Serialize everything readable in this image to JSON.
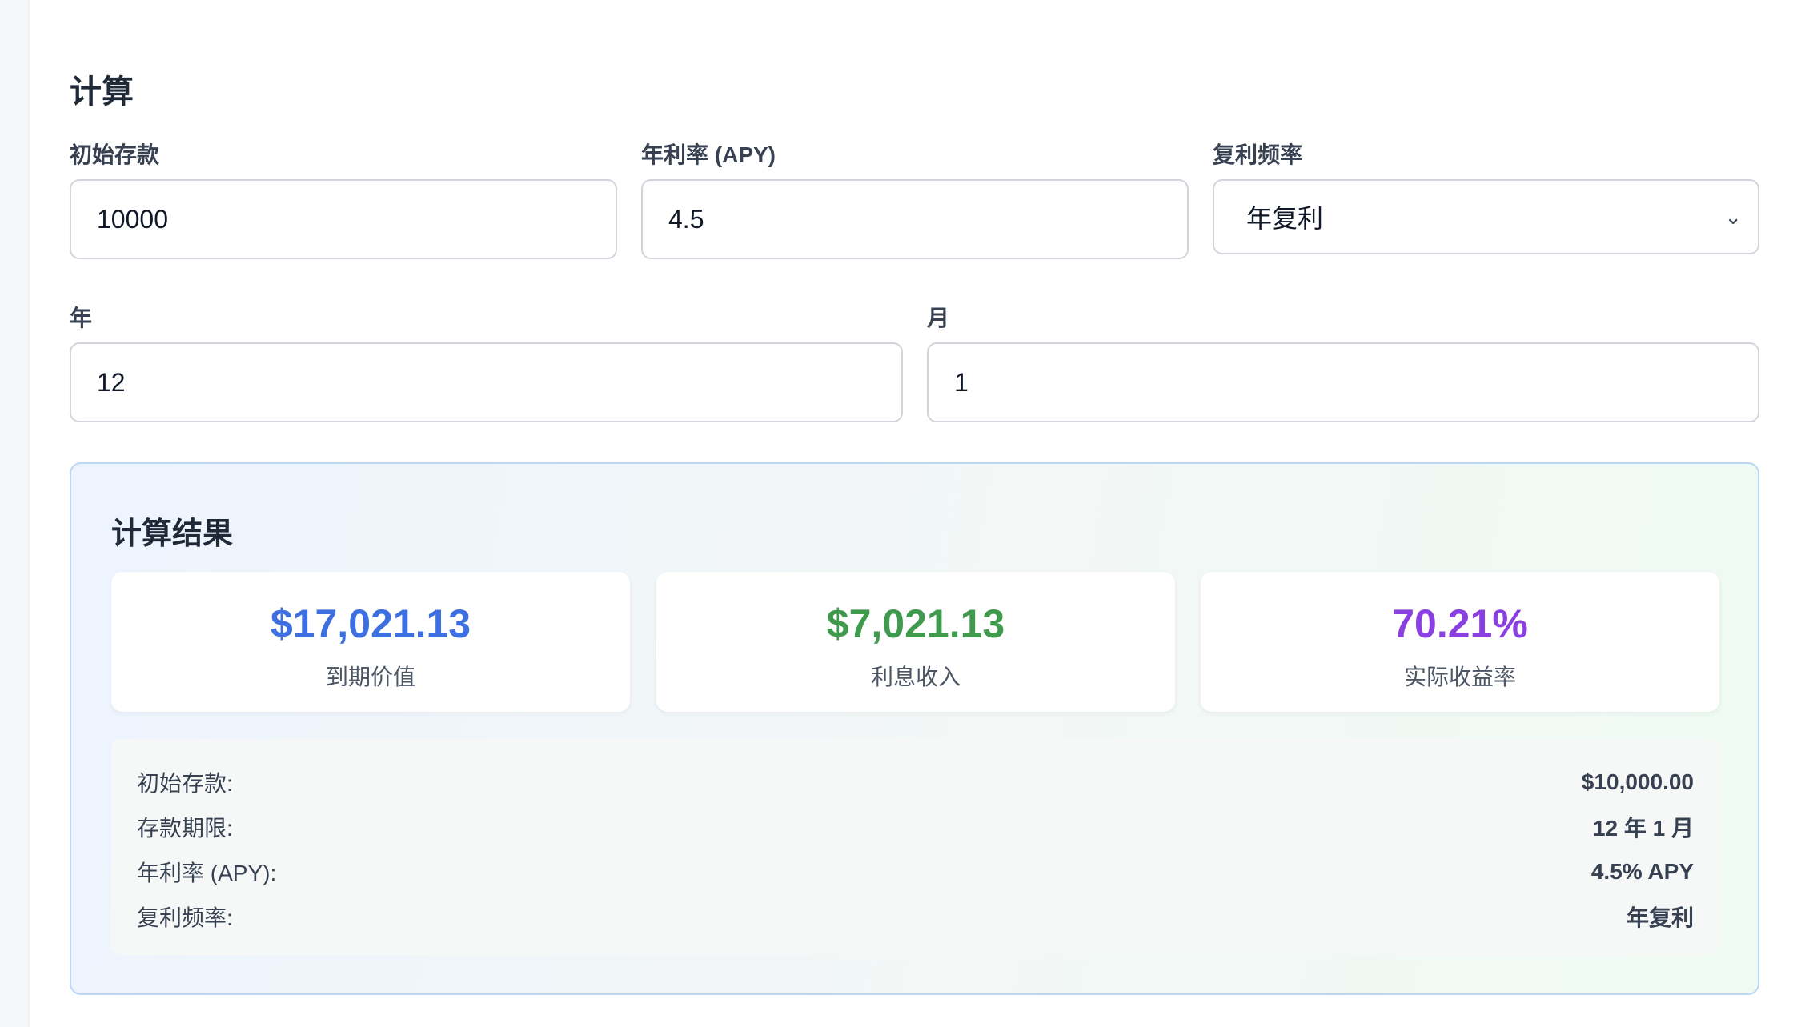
{
  "calc": {
    "title": "计算",
    "deposit": {
      "label": "初始存款",
      "value": "10000"
    },
    "rate": {
      "label": "年利率 (APY)",
      "value": "4.5"
    },
    "frequency": {
      "label": "复利频率",
      "value": "年复利",
      "icon": "chevron-down-icon"
    },
    "years": {
      "label": "年",
      "value": "12"
    },
    "months": {
      "label": "月",
      "value": "1"
    }
  },
  "results": {
    "title": "计算结果",
    "cards": [
      {
        "value": "$17,021.13",
        "label": "到期价值",
        "color": "#3e6fe0"
      },
      {
        "value": "$7,021.13",
        "label": "利息收入",
        "color": "#3f9a4e"
      },
      {
        "value": "70.21%",
        "label": "实际收益率",
        "color": "#8a3fe0"
      }
    ],
    "details": [
      {
        "key": "初始存款:",
        "value": "$10,000.00"
      },
      {
        "key": "存款期限:",
        "value": "12 年 1 月"
      },
      {
        "key": "年利率 (APY):",
        "value": "4.5% APY"
      },
      {
        "key": "复利频率:",
        "value": "年复利"
      }
    ]
  }
}
